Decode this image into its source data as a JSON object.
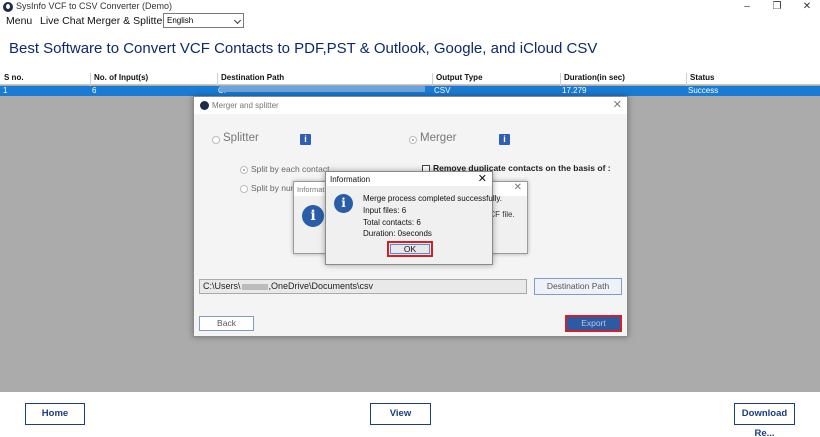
{
  "window": {
    "title": "SysInfo VCF to CSV Converter (Demo)",
    "controls": {
      "minimize": "–",
      "maximize": "❐",
      "close": "✕"
    }
  },
  "menu": {
    "items": [
      "Menu",
      "Live Chat",
      "Merger & Splitter"
    ],
    "language_selected": "English"
  },
  "heading": "Best Software to Convert VCF Contacts to PDF,PST & Outlook, Google, and iCloud CSV",
  "grid": {
    "columns": [
      "S no.",
      "No. of Input(s)",
      "Destination Path",
      "Output Type",
      "Duration(in sec)",
      "Status"
    ],
    "rows": [
      {
        "sno": "1",
        "inputs": "6",
        "path_prefix": "C:",
        "output_type": "CSV",
        "duration": "17.279",
        "status": "Success"
      }
    ]
  },
  "bottom_buttons": {
    "home": "Home",
    "view": "View",
    "download": "Download Re..."
  },
  "merger_dialog": {
    "title": "Merger and splitter",
    "splitter_label": "Splitter",
    "merger_label": "Merger",
    "split_each": "Split by each contact",
    "split_num": "Split by num",
    "remove_dup": "Remove duplicate contacts on the basis of :",
    "path_prefix": "C:\\Users\\",
    "path_suffix": ",OneDrive\\Documents\\csv",
    "destination_button": "Destination Path",
    "back_button": "Back",
    "export_button": "Export",
    "accent_color": "#2c5aa3",
    "highlight_color": "#d0202a"
  },
  "info_back": {
    "title": "Informatio",
    "text_fragment": "VCF file."
  },
  "info_front": {
    "title": "Information",
    "close": "✕",
    "lines": [
      "Merge process completed successfully.",
      "Input files: 6",
      "Total contacts: 6",
      "Duration: 0seconds"
    ],
    "ok_button": "OK"
  },
  "icons": {
    "info": "i"
  }
}
